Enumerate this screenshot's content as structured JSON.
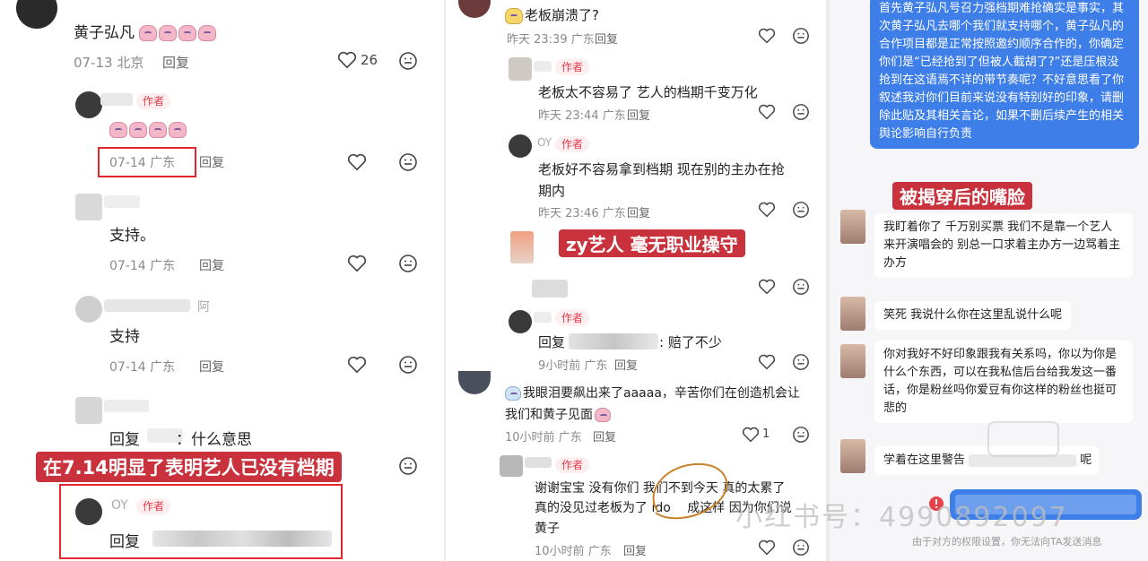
{
  "left": {
    "top_comment": {
      "name": "黄子弘凡",
      "date": "07-13",
      "location": "北京",
      "reply": "回复",
      "likes": "26"
    },
    "author_reply": {
      "badge": "作者",
      "date": "07-14",
      "location": "广东",
      "reply": "回复"
    },
    "comment2": {
      "text": "支持。",
      "date": "07-14",
      "location": "广东",
      "reply": "回复"
    },
    "comment3": {
      "name_frag": "阿",
      "text": "支持",
      "date": "07-14",
      "location": "广东",
      "reply": "回复"
    },
    "comment4": {
      "reply_prefix": "回复",
      "text": "：什么意思"
    },
    "banner": "在7.14明显了表明艺人已没有档期",
    "comment5": {
      "name_frag": "OY",
      "badge": "作者",
      "reply_prefix": "回复"
    }
  },
  "middle": {
    "c1": {
      "text": "老板崩溃了?",
      "time": "昨天 23:39",
      "location": "广东",
      "reply": "回复"
    },
    "c2": {
      "badge": "作者",
      "text": "老板太不容易了 艺人的档期千变万化",
      "time": "昨天 23:44",
      "location": "广东",
      "reply": "回复"
    },
    "c3": {
      "name_frag": "OY",
      "badge": "作者",
      "text_line1": "老板好不容易拿到档期 现在别的主办在抢",
      "text_line2": "期内",
      "time": "昨天 23:46",
      "location": "广东",
      "reply": "回复"
    },
    "banner": "zy艺人 毫无职业操守",
    "c4": {
      "badge": "作者",
      "reply_prefix": "回复",
      "text": ": 赔了不少",
      "time": "9小时前",
      "location": "广东",
      "reply": "回复"
    },
    "c5": {
      "text_line1": "我眼泪要飙出来了aaaaa，辛苦你们在创造机会让",
      "text_line2": "我们和黄子见面",
      "time": "10小时前",
      "location": "广东",
      "reply": "回复",
      "likes": "1"
    },
    "c6": {
      "badge": "作者",
      "text_line1": "谢谢宝宝 没有你们 我们不到今天 真的太累了",
      "text_line2": "真的没见过老板为了 ido",
      "text_line2b": "成这样 因为你们说",
      "text_line3": "黄子",
      "time": "10小时前",
      "location": "广东",
      "reply": "回复"
    }
  },
  "right": {
    "bubble_top": "首先黄子弘凡号召力强档期难抢确实是事实，其次黄子弘凡去哪个我们就支持哪个，黄子弘凡的合作项目都是正常按照邀约顺序合作的，你确定你们是“已经抢到了但被人截胡了?”还是压根没抢到在这语焉不详的带节奏呢？不好意思看了你叙述我对你们目前来说没有特别好的印象，请删除此贴及其相关言论，如果不删后续产生的相关舆论影响自行负责",
    "banner": "被揭穿后的嘴脸",
    "m1": "我盯着你了 千万别买票 我们不是靠一个艺人来开演唱会的 别总一口求着主办方一边骂着主办方",
    "m2": "笑死 我说什么你在这里乱说什么呢",
    "m3": "你对我好不好印象跟我有关系吗，你以为你是什么个东西，可以在我私信后台给我发这一番话，你是粉丝吗你爱豆有你这样的粉丝也挺可悲的",
    "m4": "学着在这里警告",
    "m4_tail": "呢",
    "notice": "由于对方的权限设置，你无法向TA发送消息"
  },
  "watermark": "小红书号：4990892097"
}
